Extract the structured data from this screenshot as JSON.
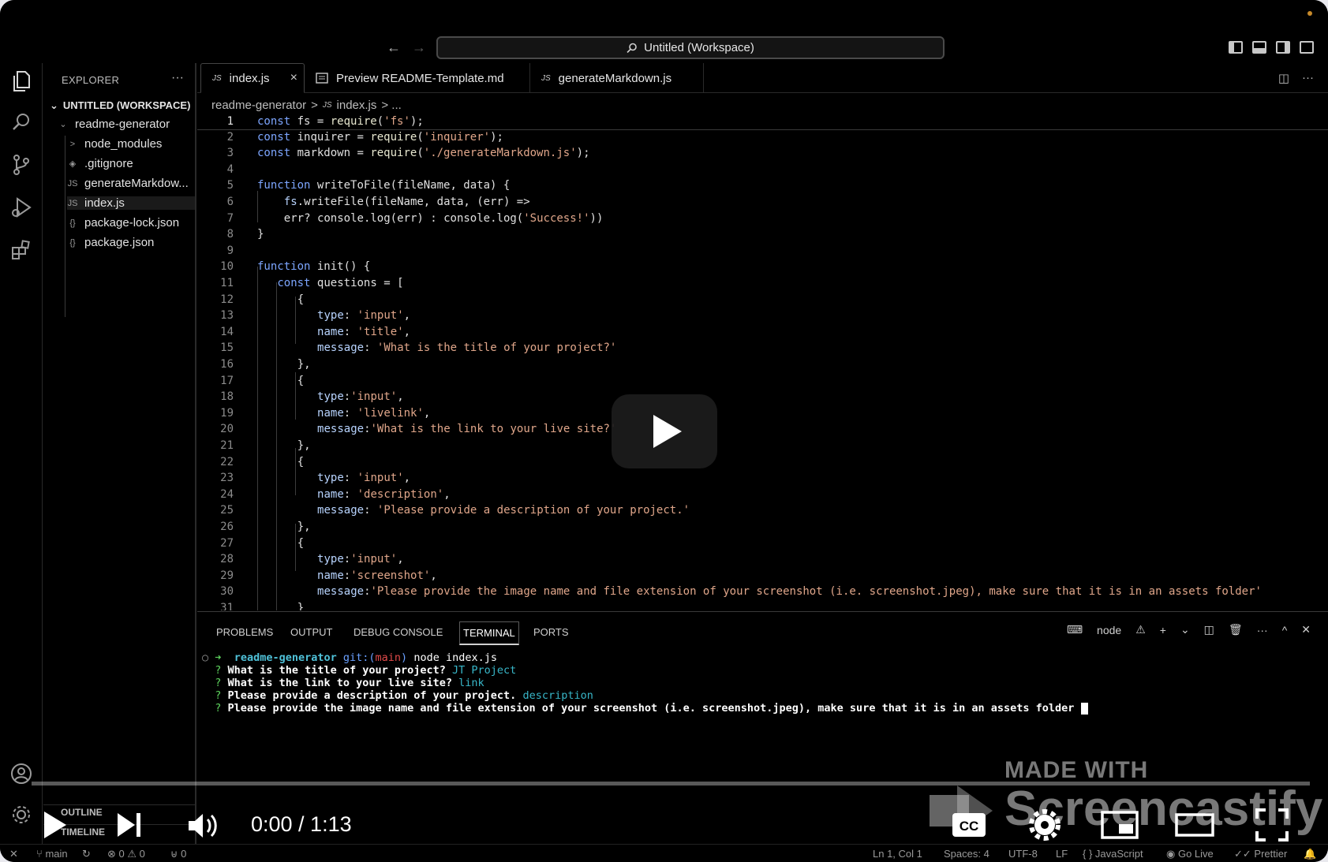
{
  "titlebar": {
    "back_glyph": "←",
    "forward_glyph": "→",
    "search_text": "Untitled (Workspace)"
  },
  "activity_bar": {
    "icons": [
      "explorer-icon",
      "search-icon",
      "source-control-icon",
      "run-debug-icon",
      "extensions-icon",
      "account-icon",
      "manage-gear-icon"
    ]
  },
  "sidebar": {
    "header": "EXPLORER",
    "more": "···",
    "workspace": "UNTITLED (WORKSPACE)",
    "folder": "readme-generator",
    "items": [
      {
        "label": "node_modules",
        "icon": ">"
      },
      {
        "label": ".gitignore",
        "icon": "◈"
      },
      {
        "label": "generateMarkdow...",
        "icon": "JS"
      },
      {
        "label": "index.js",
        "icon": "JS"
      },
      {
        "label": "package-lock.json",
        "icon": "{}"
      },
      {
        "label": "package.json",
        "icon": "{}"
      }
    ],
    "outline": "OUTLINE",
    "timeline": "TIMELINE"
  },
  "tabs": [
    {
      "label": "index.js",
      "icon": "JS",
      "active": true
    },
    {
      "label": "Preview README-Template.md",
      "icon": "preview-icon",
      "active": false
    },
    {
      "label": "generateMarkdown.js",
      "icon": "JS",
      "active": false
    }
  ],
  "tab_close": "×",
  "breadcrumb": {
    "folder": "readme-generator",
    "sep": ">",
    "js": "JS",
    "file": "index.js",
    "tail": "> ..."
  },
  "editor": {
    "lines": [
      {
        "n": "1"
      },
      {
        "n": "2"
      },
      {
        "n": "3"
      },
      {
        "n": "4"
      },
      {
        "n": "5"
      },
      {
        "n": "6"
      },
      {
        "n": "7"
      },
      {
        "n": "8"
      },
      {
        "n": "9"
      },
      {
        "n": "10"
      },
      {
        "n": "11"
      },
      {
        "n": "12"
      },
      {
        "n": "13"
      },
      {
        "n": "14"
      },
      {
        "n": "15"
      },
      {
        "n": "16"
      },
      {
        "n": "17"
      },
      {
        "n": "18"
      },
      {
        "n": "19"
      },
      {
        "n": "20"
      },
      {
        "n": "21"
      },
      {
        "n": "22"
      },
      {
        "n": "23"
      },
      {
        "n": "24"
      },
      {
        "n": "25"
      },
      {
        "n": "26"
      },
      {
        "n": "27"
      },
      {
        "n": "28"
      },
      {
        "n": "29"
      },
      {
        "n": "30"
      },
      {
        "n": "31"
      }
    ],
    "code": {
      "l1": [
        "const",
        " fs = ",
        "require",
        "(",
        "'fs'",
        ");"
      ],
      "l2": [
        "const",
        " inquirer = ",
        "require",
        "(",
        "'inquirer'",
        ");"
      ],
      "l3": [
        "const",
        " markdown = ",
        "require",
        "(",
        "'./generateMarkdown.js'",
        ");"
      ],
      "l5": [
        "function",
        " writeToFile(fileName, data) {"
      ],
      "l6": [
        "fs",
        ".writeFile(fileName, data, (err) =>"
      ],
      "l7": [
        "err? console.log(err) : console.log(",
        "'Success!'",
        "))"
      ],
      "l8": [
        "}"
      ],
      "l10": [
        "function",
        " init() {"
      ],
      "l11": [
        "const",
        " questions = ["
      ],
      "l12": [
        "{"
      ],
      "l13": [
        "type",
        ": ",
        "'input'",
        ","
      ],
      "l14": [
        "name",
        ": ",
        "'title'",
        ","
      ],
      "l15": [
        "message",
        ": ",
        "'What is the title of your project?'"
      ],
      "l16": [
        "},"
      ],
      "l17": [
        "{"
      ],
      "l18": [
        "type",
        ":",
        "'input'",
        ","
      ],
      "l19": [
        "name",
        ": ",
        "'livelink'",
        ","
      ],
      "l20": [
        "message",
        ":",
        "'What is the link to your live site?'"
      ],
      "l21": [
        "},"
      ],
      "l22": [
        "{"
      ],
      "l23": [
        "type",
        ": ",
        "'input'",
        ","
      ],
      "l24": [
        "name",
        ": ",
        "'description'",
        ","
      ],
      "l25": [
        "message",
        ": ",
        "'Please provide a description of your project.'"
      ],
      "l26": [
        "},"
      ],
      "l27": [
        "{"
      ],
      "l28": [
        "type",
        ":",
        "'input'",
        ","
      ],
      "l29": [
        "name",
        ":",
        "'screenshot'",
        ","
      ],
      "l30": [
        "message",
        ":",
        "'Please provide the image name and file extension of your screenshot (i.e. screenshot.jpeg), make sure that it is in an assets folder'"
      ],
      "l31": [
        "}"
      ]
    }
  },
  "panel": {
    "tabs": [
      "PROBLEMS",
      "OUTPUT",
      "DEBUG CONSOLE",
      "TERMINAL",
      "PORTS"
    ],
    "terminal_name": "node",
    "tools": [
      "+",
      "⌄",
      "◫",
      "🗑",
      "···",
      "^",
      "✕"
    ]
  },
  "terminal": {
    "prompt_dot": "○",
    "arrow": "➜",
    "dir": "readme-generator",
    "git": "git:(",
    "branch": "main",
    "git_close": ")",
    "command": "node index.js",
    "q_mark": "?",
    "q1": "What is the title of your project?",
    "a1": "JT Project",
    "q2": "What is the link to your live site?",
    "a2": "link",
    "q3": "Please provide a description of your project.",
    "a3": "description",
    "q4": "Please provide the image name and file extension of your screenshot (i.e. screenshot.jpeg), make sure that it is in an assets folder"
  },
  "statusbar": {
    "remote": "✕",
    "branch": "main",
    "sync": "↻",
    "errors": "⊗ 0 ⚠ 0",
    "ports": "⊎ 0",
    "position": "Ln 1, Col 1",
    "spaces": "Spaces: 4",
    "encoding": "UTF-8",
    "eol": "LF",
    "language": "{ } JavaScript",
    "golive": "Go Live",
    "prettier": "✓✓ Prettier",
    "bell": "🔔"
  },
  "video": {
    "time": "0:00 / 1:13",
    "watermark_top": "MADE WITH",
    "watermark_brand": "Screencastify",
    "progress": 0.0
  },
  "colors": {
    "background": "#000000",
    "keyword": "#7da6ff",
    "string": "#e0a68a",
    "terminal_green": "#5cd05c",
    "terminal_answer": "#38b7c9",
    "terminal_branch": "#e04a4a"
  }
}
